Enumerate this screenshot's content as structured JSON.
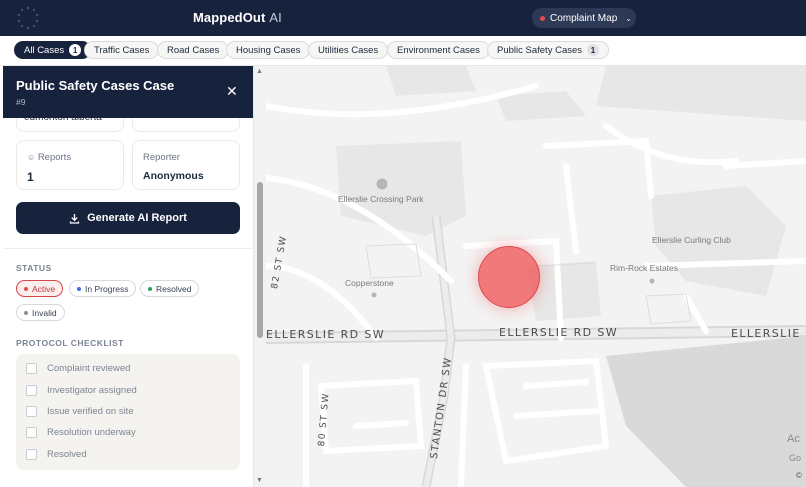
{
  "app": {
    "brand": "MappedOut",
    "brand_suffix": "AI",
    "map_selector": "Complaint Map",
    "map_selector_icon": "chevron-down-icon"
  },
  "filters": [
    {
      "label": "All Cases",
      "count": "1",
      "active": true
    },
    {
      "label": "Traffic Cases"
    },
    {
      "label": "Road Cases"
    },
    {
      "label": "Housing Cases"
    },
    {
      "label": "Utilities Cases"
    },
    {
      "label": "Environment Cases"
    },
    {
      "label": "Public Safety Cases",
      "count": "1"
    }
  ],
  "panel": {
    "title": "Public Safety Cases Case",
    "subtitle": "#9",
    "close_icon": "close-icon",
    "location_partial": "edmonton alberta",
    "reports_label": "Reports",
    "reports_value": "1",
    "reporter_label": "Reporter",
    "reporter_value": "Anonymous",
    "generate_button": "Generate AI Report",
    "status_title": "STATUS",
    "statuses": [
      {
        "label": "Active",
        "color": "#e24c52",
        "selected": true
      },
      {
        "label": "In Progress",
        "color": "#3b6fe0"
      },
      {
        "label": "Resolved",
        "color": "#2aa35a"
      },
      {
        "label": "Invalid",
        "color": "#8a8f98"
      }
    ],
    "checklist_title": "PROTOCOL CHECKLIST",
    "checklist": [
      "Complaint reviewed",
      "Investigator assigned",
      "Issue verified on site",
      "Resolution underway",
      "Resolved"
    ]
  },
  "map": {
    "labels": {
      "park": "Ellerslie Crossing Park",
      "club": "Ellerslie Curling Club",
      "estates": "Rim-Rock Estates",
      "copperstone": "Copperstone",
      "road_main": "ELLERSLIE RD SW",
      "road_main_2": "ELLERSLIE RD SW",
      "road_main_3": "ELLERSLIE RD SW",
      "road_82": "82 ST SW",
      "road_80": "80 ST SW",
      "road_stanton": "STANTON DR SW",
      "partial_a": "Ac",
      "partial_go": "Go",
      "attribution": "©"
    },
    "marker_color": "#f05050"
  }
}
